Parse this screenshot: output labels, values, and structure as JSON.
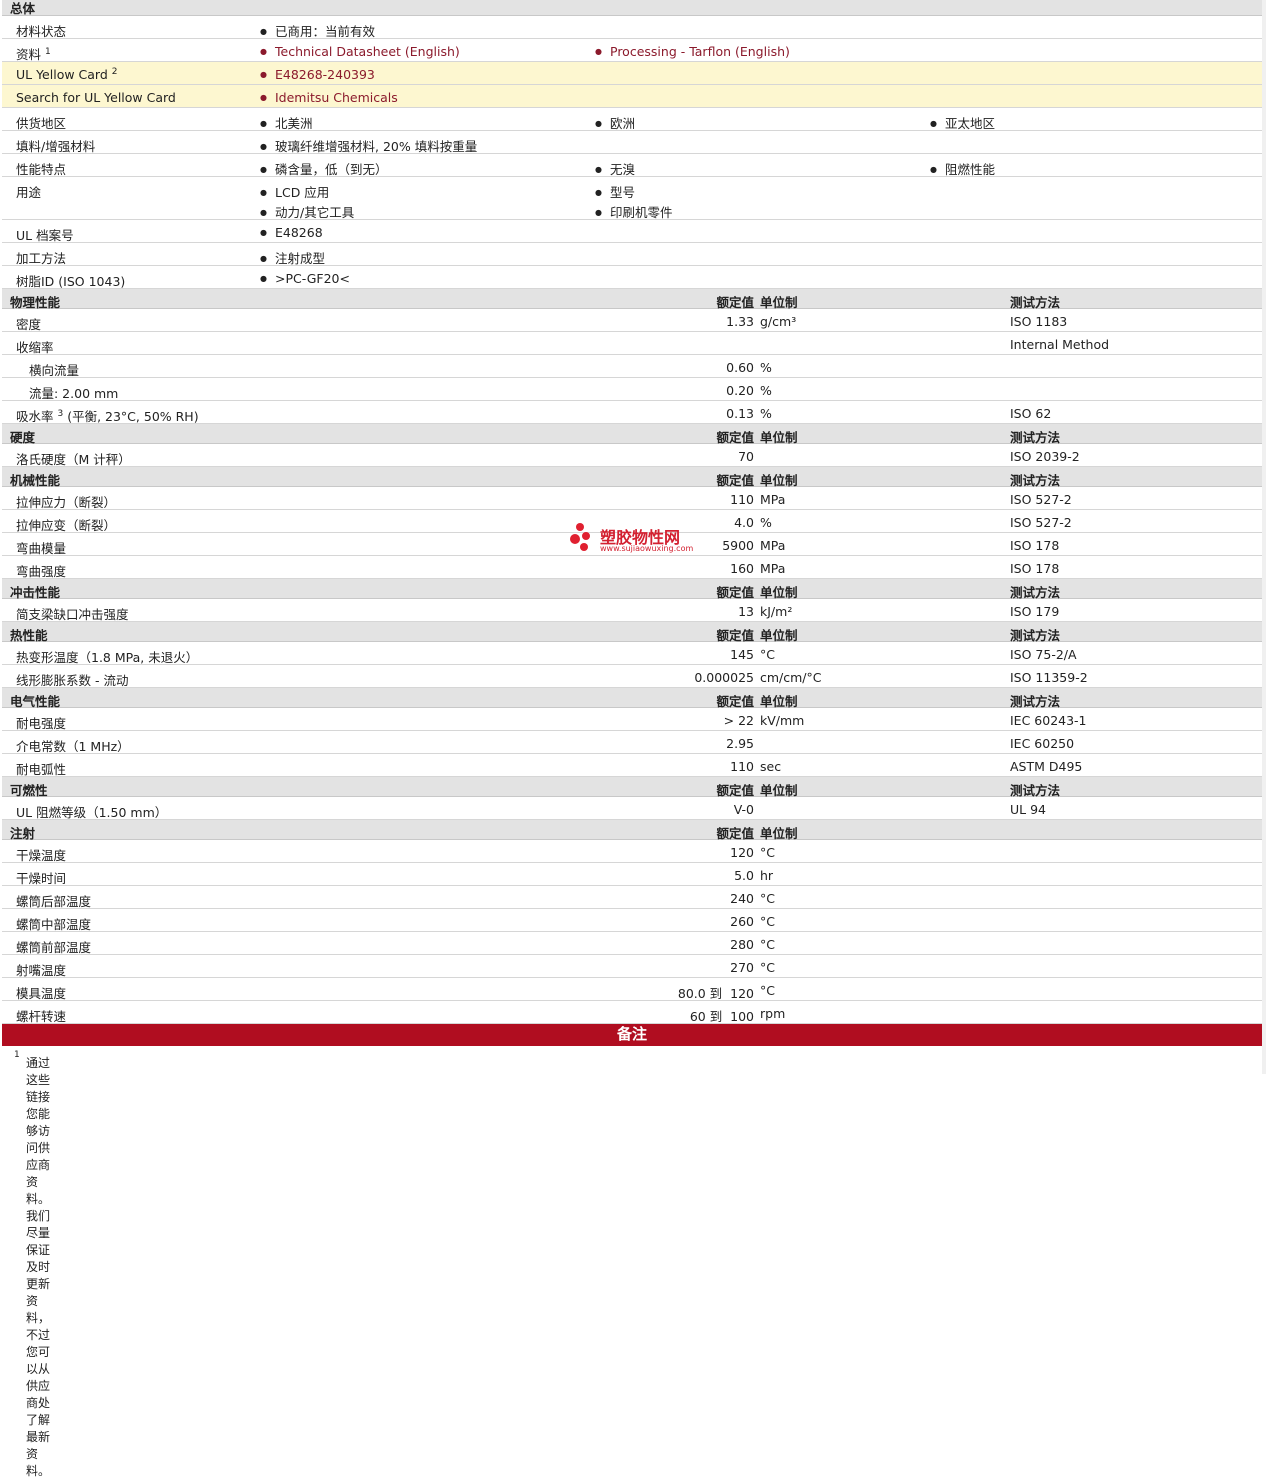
{
  "general": {
    "section_title": "总体",
    "material_status": {
      "label": "材料状态",
      "value": "已商用：当前有效"
    },
    "documents": {
      "label": "资料",
      "sup": "1",
      "links": [
        "Technical Datasheet (English)",
        "Processing - Tarflon (English)"
      ]
    },
    "ul_yellow_card": {
      "label": "UL Yellow Card",
      "sup": "2",
      "value": "E48268-240393"
    },
    "search_ul": {
      "label": "Search for UL Yellow Card",
      "value": "Idemitsu Chemicals"
    },
    "availability": {
      "label": "供货地区",
      "values": [
        "北美洲",
        "欧洲",
        "亚太地区"
      ]
    },
    "filler": {
      "label": "填料/增强材料",
      "value": "玻璃纤维增强材料, 20% 填料按重量"
    },
    "features": {
      "label": "性能特点",
      "values": [
        "磷含量，低（到无）",
        "无溴",
        "阻燃性能"
      ]
    },
    "uses": {
      "label": "用途",
      "values": [
        "LCD 应用",
        "型号",
        "动力/其它工具",
        "印刷机零件"
      ]
    },
    "ul_file": {
      "label": "UL 档案号",
      "value": "E48268"
    },
    "processing": {
      "label": "加工方法",
      "value": "注射成型"
    },
    "resin_id": {
      "label": "树脂ID (ISO 1043)",
      "value": ">PC-GF20<"
    }
  },
  "headers": {
    "value": "额定值",
    "unit": "单位制",
    "method": "测试方法"
  },
  "physical": {
    "title": "物理性能",
    "rows": [
      {
        "label": "密度",
        "value": "1.33",
        "unit": "g/cm³",
        "method": "ISO 1183"
      },
      {
        "label": "收缩率",
        "value": "",
        "unit": "",
        "method": "Internal Method"
      },
      {
        "label": "横向流量",
        "value": "0.60",
        "unit": "%",
        "method": ""
      },
      {
        "label": "流量: 2.00 mm",
        "value": "0.20",
        "unit": "%",
        "method": ""
      },
      {
        "label": "吸水率",
        "sup": "3",
        "label2": " (平衡, 23°C, 50% RH)",
        "value": "0.13",
        "unit": "%",
        "method": "ISO 62"
      }
    ]
  },
  "hardness": {
    "title": "硬度",
    "rows": [
      {
        "label": "洛氏硬度（M 计秤）",
        "value": "70",
        "unit": "",
        "method": "ISO 2039-2"
      }
    ]
  },
  "mechanical": {
    "title": "机械性能",
    "rows": [
      {
        "label": "拉伸应力（断裂）",
        "value": "110",
        "unit": "MPa",
        "method": "ISO 527-2"
      },
      {
        "label": "拉伸应变（断裂）",
        "value": "4.0",
        "unit": "%",
        "method": "ISO 527-2"
      },
      {
        "label": "弯曲模量",
        "value": "5900",
        "unit": "MPa",
        "method": "ISO 178"
      },
      {
        "label": "弯曲强度",
        "value": "160",
        "unit": "MPa",
        "method": "ISO 178"
      }
    ]
  },
  "impact": {
    "title": "冲击性能",
    "rows": [
      {
        "label": "简支梁缺口冲击强度",
        "value": "13",
        "unit": "kJ/m²",
        "method": "ISO 179"
      }
    ]
  },
  "thermal": {
    "title": "热性能",
    "rows": [
      {
        "label": "热变形温度（1.8 MPa, 未退火）",
        "value": "145",
        "unit": "°C",
        "method": "ISO 75-2/A"
      },
      {
        "label": "线形膨胀系数 - 流动",
        "value": "0.000025",
        "unit": "cm/cm/°C",
        "method": "ISO 11359-2"
      }
    ]
  },
  "electrical": {
    "title": "电气性能",
    "rows": [
      {
        "label": "耐电强度",
        "value": "> 22",
        "unit": "kV/mm",
        "method": "IEC 60243-1"
      },
      {
        "label": "介电常数（1 MHz）",
        "value": "2.95",
        "unit": "",
        "method": "IEC 60250"
      },
      {
        "label": "耐电弧性",
        "value": "110",
        "unit": "sec",
        "method": "ASTM D495"
      }
    ]
  },
  "flammability": {
    "title": "可燃性",
    "rows": [
      {
        "label": "UL 阻燃等级（1.50 mm）",
        "value": "V-0",
        "unit": "",
        "method": "UL 94"
      }
    ]
  },
  "injection": {
    "title": "注射",
    "rows": [
      {
        "label": "干燥温度",
        "value": "120",
        "unit": "°C"
      },
      {
        "label": "干燥时间",
        "value": "5.0",
        "unit": "hr"
      },
      {
        "label": "螺筒后部温度",
        "value": "240",
        "unit": "°C"
      },
      {
        "label": "螺筒中部温度",
        "value": "260",
        "unit": "°C"
      },
      {
        "label": "螺筒前部温度",
        "value": "280",
        "unit": "°C"
      },
      {
        "label": "射嘴温度",
        "value": "270",
        "unit": "°C"
      },
      {
        "label": "模具温度",
        "value": "80.0 到  120",
        "unit": "°C"
      },
      {
        "label": "螺杆转速",
        "value": "60 到  100",
        "unit": "rpm"
      }
    ]
  },
  "notes": {
    "title": "备注",
    "note1_sup": "1",
    "note1": "通过这些链接您能够访问供应商资料。我们尽量保证及时更新资料，不过您可以从供应商处了解最新资料。"
  },
  "watermark": {
    "name": "塑胶物性网",
    "url": "www.sujiaowuxing.com"
  },
  "colors": {
    "accent": "#b00d20",
    "link": "#8b1a2c",
    "highlight": "#fdf7d0",
    "section": "#e3e3e3"
  }
}
